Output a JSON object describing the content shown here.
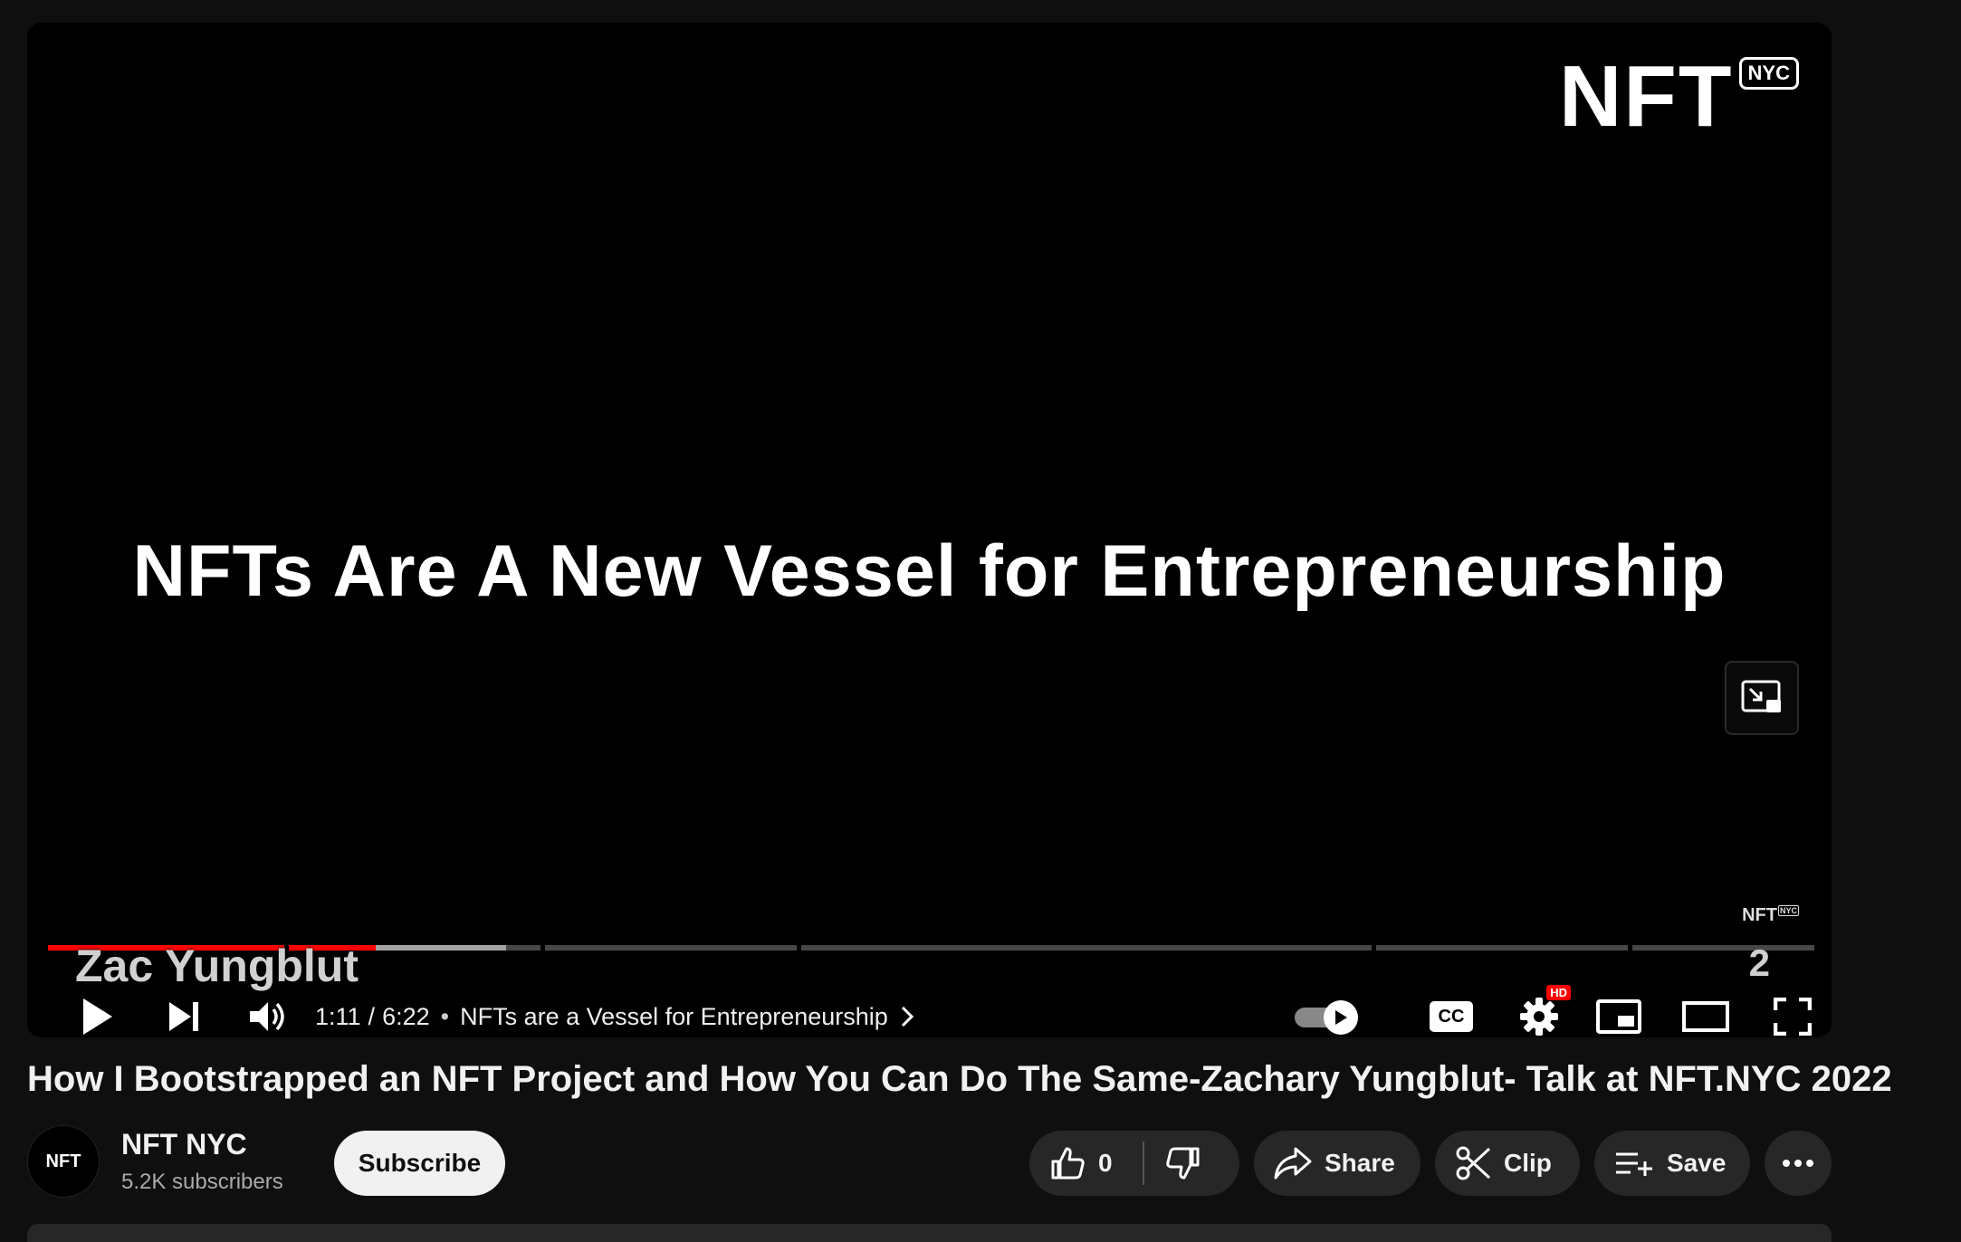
{
  "player": {
    "brand_logo": {
      "main": "NFT",
      "badge": "NYC"
    },
    "slide_text": "NFTs Are A New Vessel for Entrepreneurship",
    "watermark": {
      "main": "NFT",
      "badge": "NYC"
    },
    "caption_overlay": "Zac Yungblut",
    "chapter_number_overlay": "2",
    "progress": {
      "played_fraction": 0.186,
      "buffered_fraction": 0.26,
      "chapter_count": 6
    },
    "controls": {
      "current_time": "1:11",
      "separator": "/",
      "duration": "6:22",
      "dot": "•",
      "chapter_title": "NFTs are a Vessel for Entrepreneurship",
      "autoplay": "on",
      "settings_badge": "HD",
      "cc_label": "CC"
    }
  },
  "video": {
    "title": "How I Bootstrapped an NFT Project and How You Can Do The Same-Zachary Yungblut- Talk at NFT.NYC 2022"
  },
  "channel": {
    "avatar_text": "NFT",
    "name": "NFT NYC",
    "subscribers": "5.2K subscribers",
    "subscribe_label": "Subscribe"
  },
  "actions": {
    "like_count": "0",
    "share_label": "Share",
    "clip_label": "Clip",
    "save_label": "Save"
  },
  "colors": {
    "background": "#0f0f0f",
    "progress_played": "#ff0000",
    "pill_bg": "#272727",
    "subscribe_bg": "#f1f1f1"
  }
}
